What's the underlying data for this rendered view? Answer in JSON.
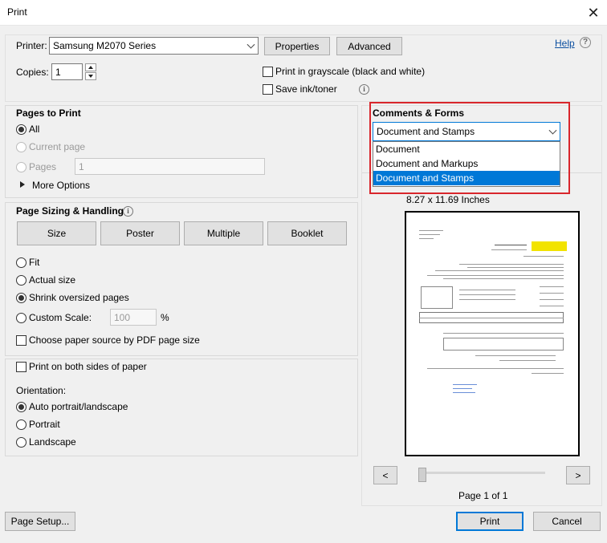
{
  "window": {
    "title": "Print",
    "close_glyph": "✕"
  },
  "help": {
    "label": "Help",
    "icon": "help-icon",
    "icon_glyph": "?"
  },
  "printer": {
    "label": "Printer:",
    "value": "Samsung M2070 Series",
    "properties_label": "Properties",
    "advanced_label": "Advanced"
  },
  "copies": {
    "label": "Copies:",
    "value": "1"
  },
  "options": {
    "grayscale_label": "Print in grayscale (black and white)",
    "save_ink_label": "Save ink/toner"
  },
  "pages_to_print": {
    "heading": "Pages to Print",
    "all_label": "All",
    "current_label": "Current page",
    "pages_label": "Pages",
    "pages_value": "1",
    "more_options_label": "More Options"
  },
  "sizing": {
    "heading": "Page Sizing & Handling",
    "tabs": [
      "Size",
      "Poster",
      "Multiple",
      "Booklet"
    ],
    "fit_label": "Fit",
    "actual_label": "Actual size",
    "shrink_label": "Shrink oversized pages",
    "custom_label": "Custom Scale:",
    "custom_value": "100",
    "percent": "%",
    "paper_source_label": "Choose paper source by PDF page size"
  },
  "duplex": {
    "label": "Print on both sides of paper"
  },
  "orientation": {
    "heading": "Orientation:",
    "auto_label": "Auto portrait/landscape",
    "portrait_label": "Portrait",
    "landscape_label": "Landscape"
  },
  "comments_forms": {
    "heading": "Comments & Forms",
    "selected": "Document and Stamps",
    "options": [
      "Document",
      "Document and Markups",
      "Document and Stamps"
    ]
  },
  "preview": {
    "dimensions": "8.27 x 11.69 Inches",
    "prev_glyph": "<",
    "next_glyph": ">",
    "page_info": "Page 1 of 1"
  },
  "footer": {
    "page_setup_label": "Page Setup...",
    "print_label": "Print",
    "cancel_label": "Cancel"
  },
  "colors": {
    "accent": "#0078d7",
    "highlight_border": "#d9262c",
    "help_link": "#0b4fa0"
  }
}
